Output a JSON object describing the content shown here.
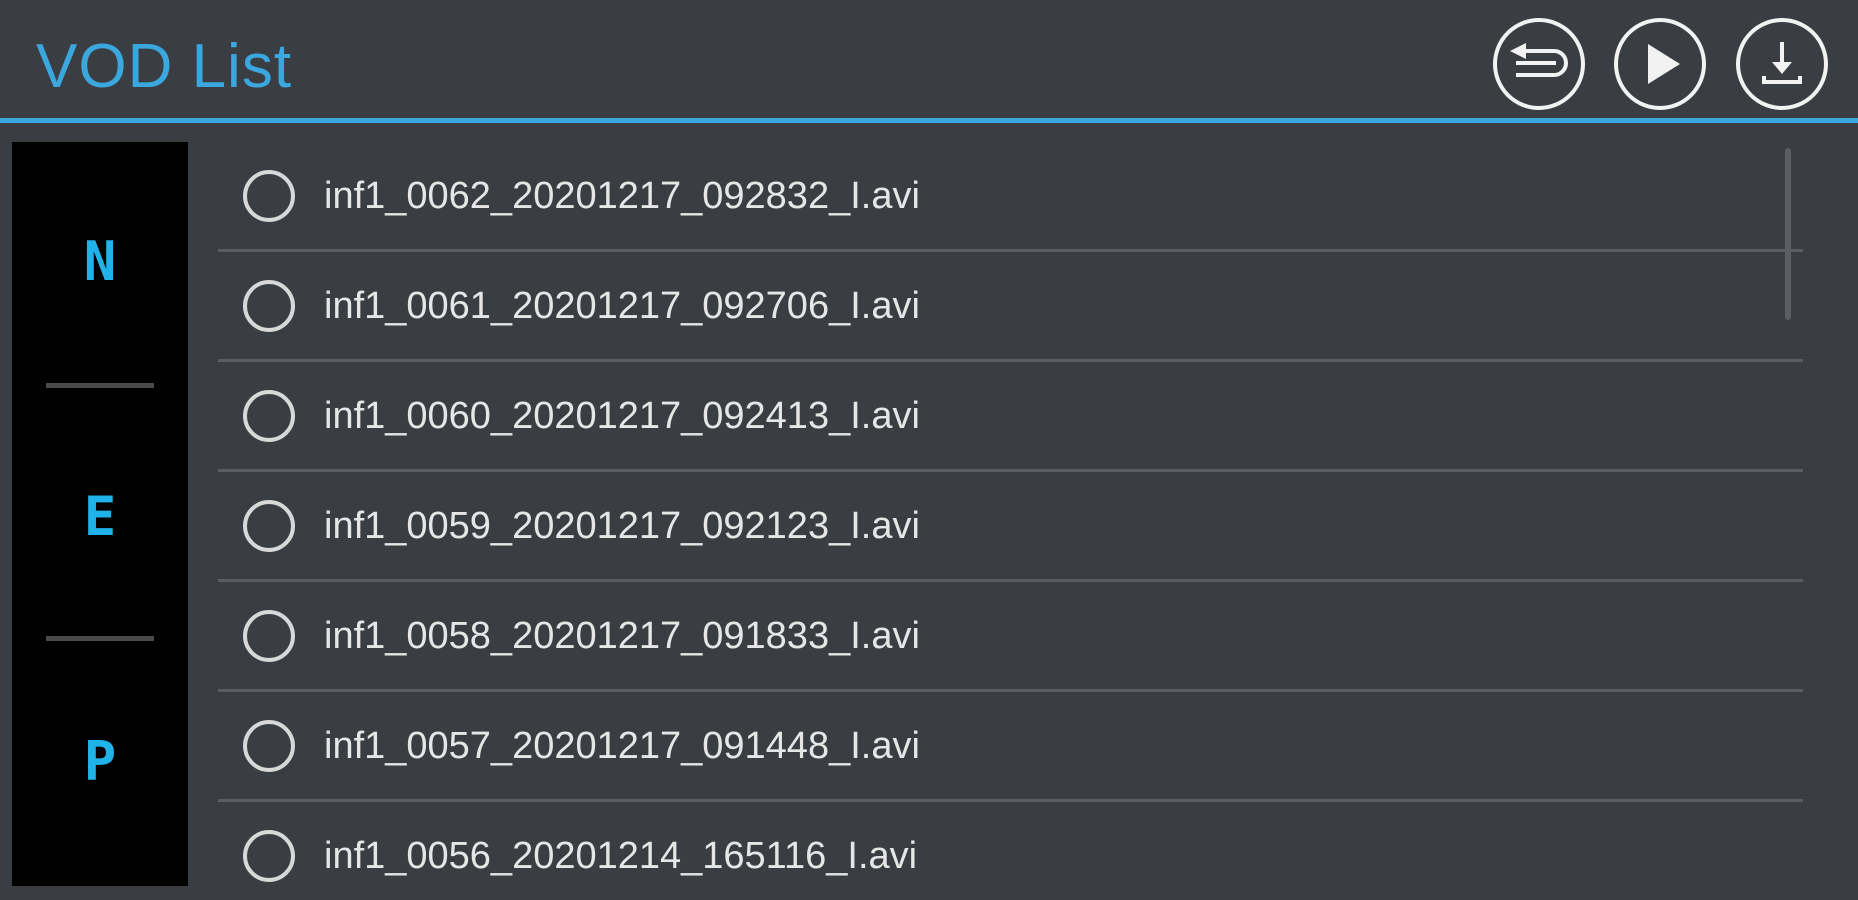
{
  "header": {
    "title": "VOD List",
    "accent_color": "#3aa8de",
    "buttons": [
      {
        "icon": "back-icon"
      },
      {
        "icon": "play-icon"
      },
      {
        "icon": "download-icon"
      }
    ]
  },
  "side_panel": {
    "letters": [
      "N",
      "E",
      "P"
    ],
    "letter_color": "#1fb3ea"
  },
  "files": [
    {
      "name": "inf1_0062_20201217_092832_I.avi"
    },
    {
      "name": "inf1_0061_20201217_092706_I.avi"
    },
    {
      "name": "inf1_0060_20201217_092413_I.avi"
    },
    {
      "name": "inf1_0059_20201217_092123_I.avi"
    },
    {
      "name": "inf1_0058_20201217_091833_I.avi"
    },
    {
      "name": "inf1_0057_20201217_091448_I.avi"
    },
    {
      "name": "inf1_0056_20201214_165116_I.avi"
    }
  ]
}
